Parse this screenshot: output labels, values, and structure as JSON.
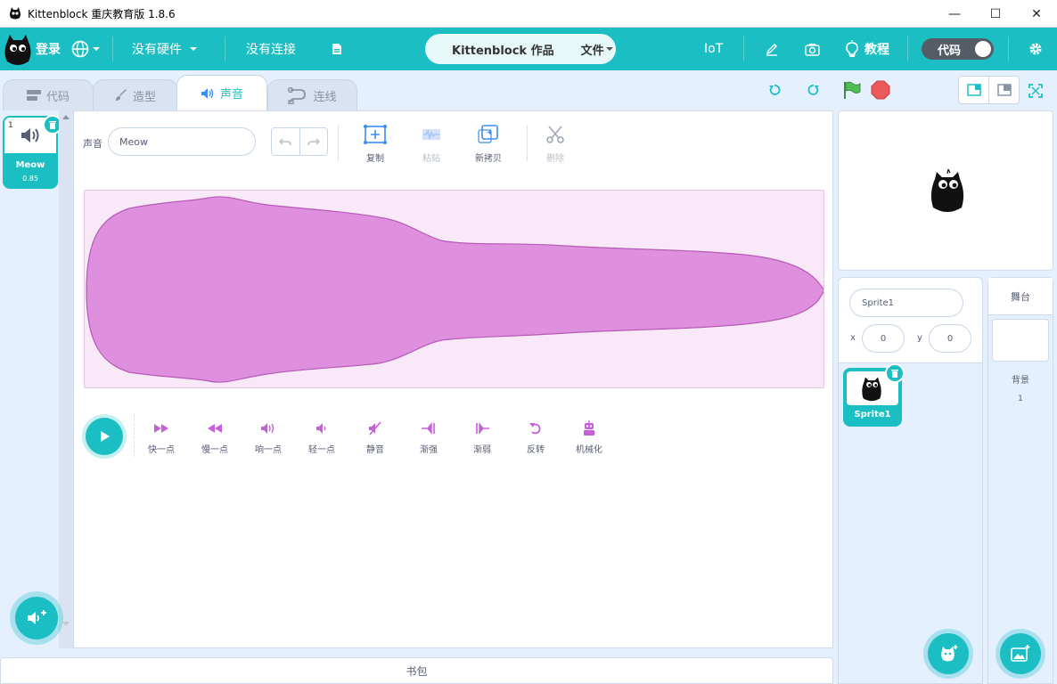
{
  "window": {
    "title": "Kittenblock 重庆教育版 1.8.6",
    "minimize": "—",
    "maximize": "☐",
    "close": "✕"
  },
  "menubar": {
    "login": "登录",
    "hardware": "没有硬件",
    "connection": "没有连接",
    "project_title": "Kittenblock 作品",
    "file_menu": "文件",
    "iot": "IoT",
    "tutorial": "教程",
    "code_toggle": "代码"
  },
  "tabs": [
    {
      "label": "代码"
    },
    {
      "label": "造型"
    },
    {
      "label": "声音"
    },
    {
      "label": "连线"
    }
  ],
  "sounds": [
    {
      "index": "1",
      "name": "Meow",
      "duration": "0.85"
    }
  ],
  "editor": {
    "sound_label": "声音",
    "sound_name": "Meow",
    "tools": {
      "copy": "复制",
      "paste": "粘贴",
      "copy_new": "新拷贝",
      "delete": "删除"
    },
    "effects": [
      {
        "label": "快一点"
      },
      {
        "label": "慢一点"
      },
      {
        "label": "响一点"
      },
      {
        "label": "轻一点"
      },
      {
        "label": "静音"
      },
      {
        "label": "渐强"
      },
      {
        "label": "渐弱"
      },
      {
        "label": "反转"
      },
      {
        "label": "机械化"
      }
    ]
  },
  "backpack": {
    "label": "书包"
  },
  "sprite_info": {
    "name": "Sprite1",
    "x_label": "x",
    "x": "0",
    "y_label": "y",
    "y": "0"
  },
  "sprites": [
    {
      "name": "Sprite1"
    }
  ],
  "stage_pane": {
    "title": "舞台",
    "backdrops_label": "背景",
    "backdrops_count": "1"
  },
  "colors": {
    "accent": "#1bbfc3",
    "sound_wave": "#de8fde",
    "green_flag": "#4cbf56",
    "stop": "#ec5959"
  }
}
